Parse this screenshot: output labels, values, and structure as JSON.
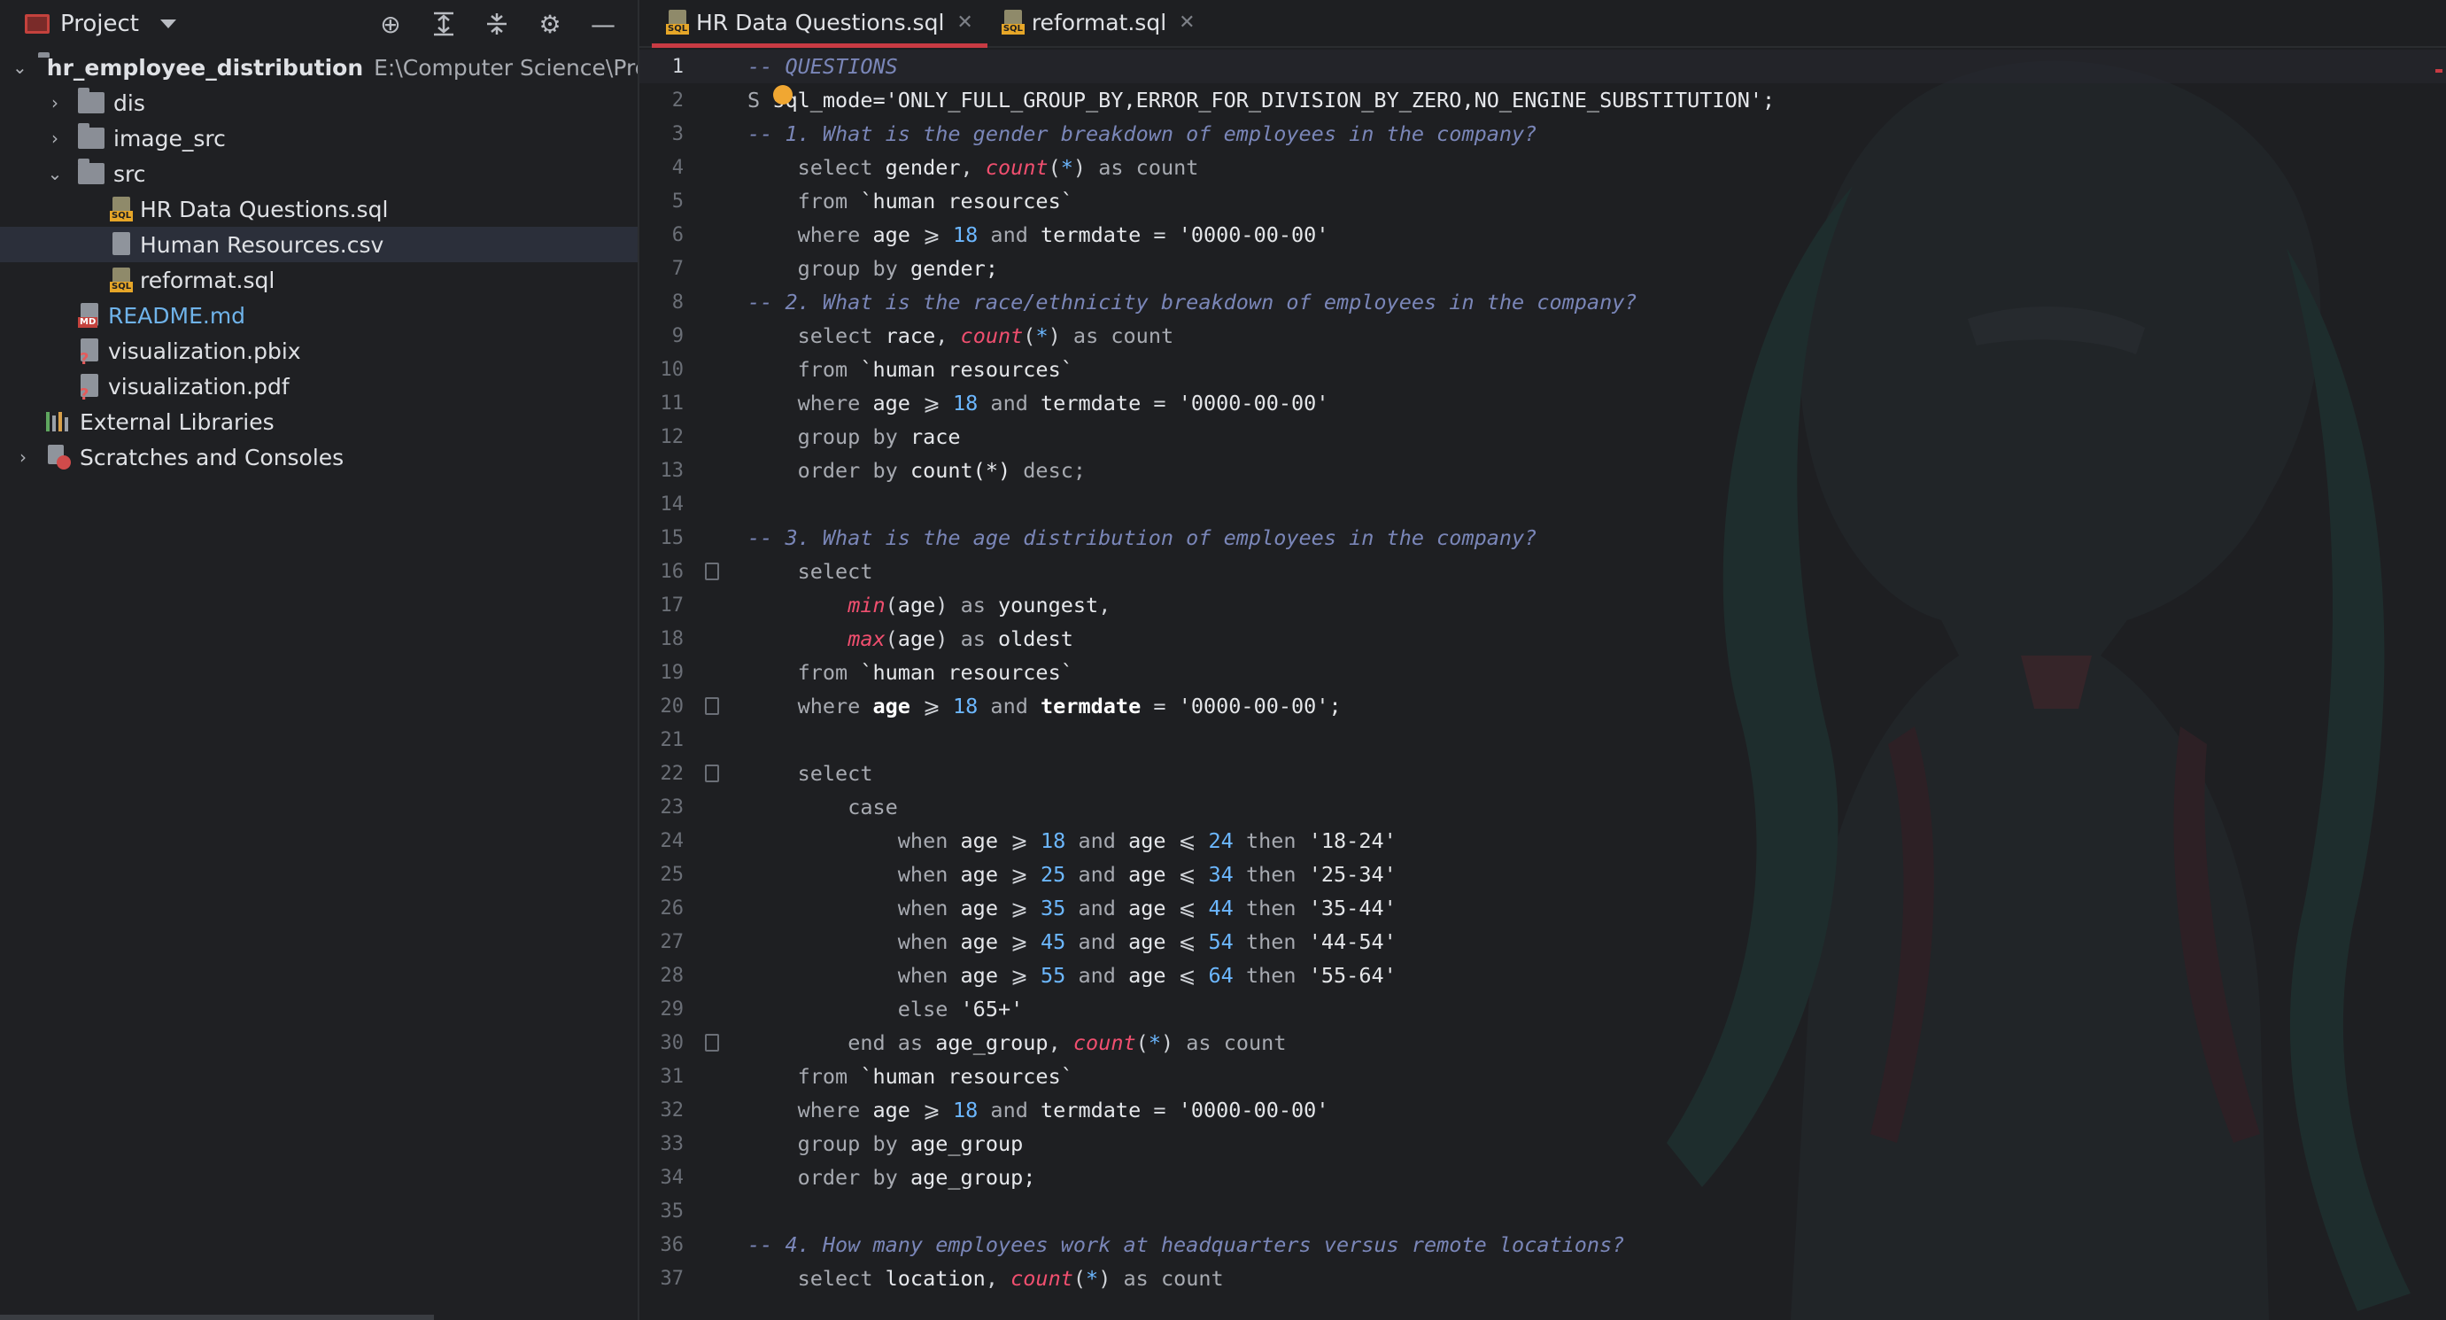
{
  "project_panel": {
    "title": "Project",
    "tools": [
      "target-icon",
      "expand-all-icon",
      "collapse-all-icon",
      "gear-icon",
      "minimize-icon"
    ],
    "tree": {
      "root_name": "hr_employee_distribution",
      "root_path": "E:\\Computer Science\\Proje",
      "dis": "dis",
      "image_src": "image_src",
      "src": "src",
      "hr_questions": "HR Data Questions.sql",
      "human_resources": "Human Resources.csv",
      "reformat": "reformat.sql",
      "readme": "README.md",
      "vis_pbix": "visualization.pbix",
      "vis_pdf": "visualization.pdf",
      "external_libraries": "External Libraries",
      "scratches": "Scratches and Consoles"
    }
  },
  "tabs": [
    {
      "label": "HR Data Questions.sql",
      "active": true
    },
    {
      "label": "reformat.sql",
      "active": false
    }
  ],
  "editor": {
    "current_line": 1,
    "line_numbers": [
      "1",
      "2",
      "3",
      "4",
      "5",
      "6",
      "7",
      "8",
      "9",
      "10",
      "11",
      "12",
      "13",
      "14",
      "15",
      "16",
      "17",
      "18",
      "19",
      "20",
      "21",
      "22",
      "23",
      "24",
      "25",
      "26",
      "27",
      "28",
      "29",
      "30",
      "31",
      "32",
      "33",
      "34",
      "35",
      "36",
      "37"
    ],
    "c": {
      "l1": "-- QUESTIONS",
      "l2a": "S",
      "l2b": " sql_mode='ONLY_FULL_GROUP_BY,ERROR_FOR_DIVISION_BY_ZERO,NO_ENGINE_SUBSTITUTION';",
      "l3": "-- 1. What is the gender breakdown of employees in the company?",
      "l8": "-- 2. What is the race/ethnicity breakdown of employees in the company?",
      "l15": "-- 3. What is the age distribution of employees in the company?",
      "l36": "-- 4. How many employees work at headquarters versus remote locations?",
      "select": "select",
      "from": "from",
      "where": "where",
      "group_by": "group by",
      "order_by": "order by",
      "and": "and",
      "as": "as",
      "case": "case",
      "when": "when",
      "then": "then",
      "else": "else",
      "end": "end",
      "desc": "desc;",
      "gender": "gender",
      "gender_semi": "gender;",
      "race": "race",
      "age": "age",
      "termdate": "termdate",
      "count_fn": "count",
      "count_word": "count",
      "count_plain": "count(*)",
      "min_fn": "min",
      "max_fn": "max",
      "youngest": "youngest",
      "oldest": "oldest",
      "age_group": "age_group",
      "age_group_semi": "age_group;",
      "location": "location",
      "table": "`human resources`",
      "date_str": "'0000-00-00'",
      "date_str_semi": "'0000-00-00';",
      "n18": "18",
      "n24": "24",
      "n25": "25",
      "n34": "34",
      "n35": "35",
      "n44": "44",
      "n45": "45",
      "n54": "54",
      "n55": "55",
      "n64": "64",
      "s18_24": "'18-24'",
      "s25_34": "'25-34'",
      "s35_44": "'35-44'",
      "s44_54": "'44-54'",
      "s55_64": "'55-64'",
      "s65": "'65+'",
      "ge": "⩾",
      "le": "⩽",
      "eq": "=",
      "star": "*",
      "lp": "(",
      "rp": ")",
      "comma": ",",
      "semi": ";"
    }
  },
  "colors": {
    "accent": "#c83b43",
    "keyword": "#a7aab1",
    "function": "#f04f6f",
    "number": "#6cb7ff",
    "comment": "#7a86b8",
    "bulb": "#f0a732"
  }
}
